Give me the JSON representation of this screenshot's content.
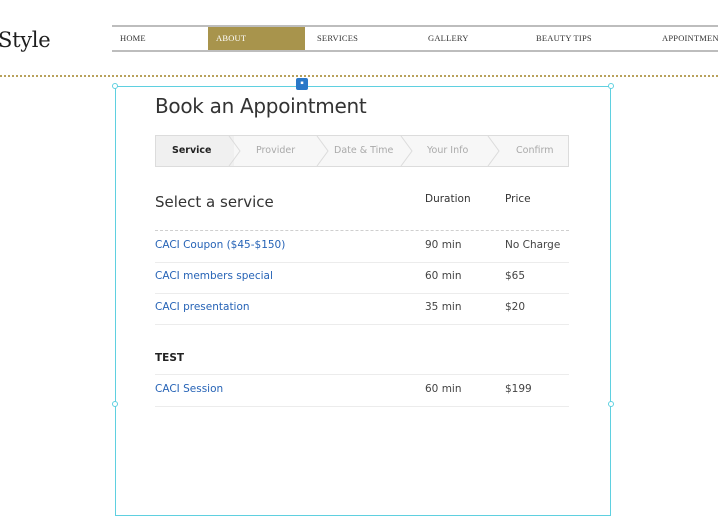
{
  "site": {
    "logo_text": "Style",
    "nav": [
      "HOME",
      "ABOUT",
      "SERVICES",
      "GALLERY",
      "BEAUTY TIPS",
      "APPOINTMENTS"
    ],
    "nav_active": "ABOUT",
    "accent_color": "#a8944c"
  },
  "widget": {
    "title": "Book an Appointment",
    "steps": [
      "Service",
      "Provider",
      "Date & Time",
      "Your Info",
      "Confirm"
    ],
    "active_step": "Service",
    "section_heading": "Select a service",
    "columns": {
      "duration": "Duration",
      "price": "Price"
    },
    "services": [
      {
        "name": "CACI Coupon ($45-$150)",
        "duration": "90 min",
        "price": "No Charge"
      },
      {
        "name": "CACI members special",
        "duration": "60 min",
        "price": "$65"
      },
      {
        "name": "CACI presentation",
        "duration": "35 min",
        "price": "$20"
      }
    ],
    "group": {
      "name": "TEST",
      "services": [
        {
          "name": "CACI Session",
          "duration": "60 min",
          "price": "$199"
        }
      ]
    },
    "link_color": "#2663b6",
    "frame_color": "#5fd0e0"
  }
}
